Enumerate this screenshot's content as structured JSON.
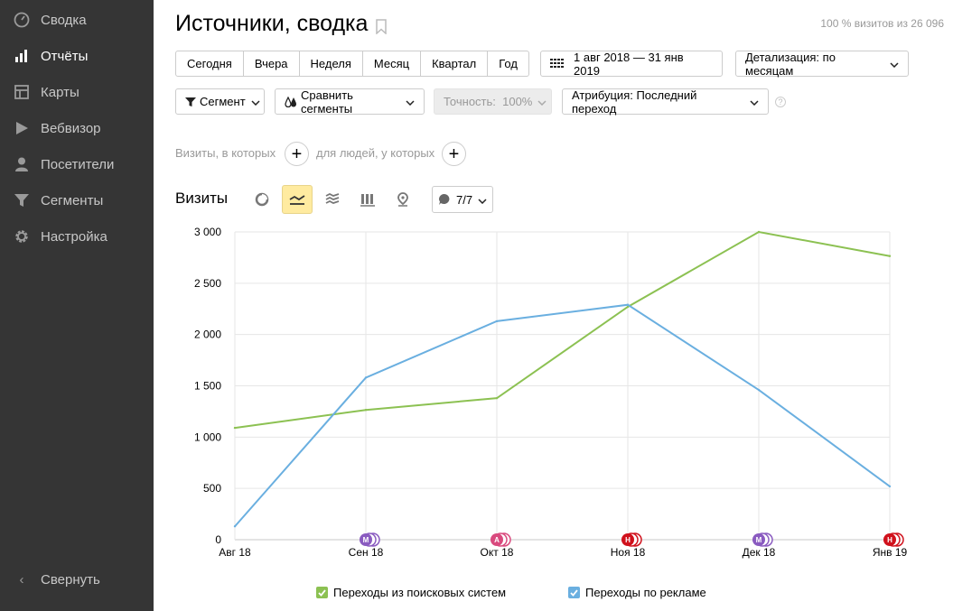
{
  "sidebar": {
    "items": [
      {
        "label": "Сводка",
        "icon": "gauge-icon",
        "active": false
      },
      {
        "label": "Отчёты",
        "icon": "bar-chart-icon",
        "active": true
      },
      {
        "label": "Карты",
        "icon": "map-icon",
        "active": false
      },
      {
        "label": "Вебвизор",
        "icon": "play-icon",
        "active": false
      },
      {
        "label": "Посетители",
        "icon": "user-icon",
        "active": false
      },
      {
        "label": "Сегменты",
        "icon": "funnel-icon",
        "active": false
      },
      {
        "label": "Настройка",
        "icon": "gear-icon",
        "active": false
      }
    ],
    "collapse_label": "Свернуть"
  },
  "header": {
    "title": "Источники, сводка",
    "coverage": "100 % визитов из 26 096"
  },
  "periods": [
    "Сегодня",
    "Вчера",
    "Неделя",
    "Месяц",
    "Квартал",
    "Год"
  ],
  "date_range": "1 авг 2018 — 31 янв 2019",
  "detail": "Детализация: по месяцам",
  "segment": "Сегмент",
  "compare": "Сравнить сегменты",
  "accuracy": "Точность:  100%",
  "attribution": "Атрибуция: Последний переход",
  "help": "?",
  "filters": {
    "visits_label": "Визиты, в которых",
    "people_label": "для людей, у которых"
  },
  "section_title": "Визиты",
  "notes_count": "7/7",
  "colors": {
    "sidebar": "#353535",
    "green": "#8cc152",
    "blue": "#6aafe0",
    "active_view": "#ffeba0"
  },
  "chart_data": {
    "type": "line",
    "categories": [
      "Авг 18",
      "Сен 18",
      "Окт 18",
      "Ноя 18",
      "Дек 18",
      "Янв 19"
    ],
    "ylim": [
      0,
      3000
    ],
    "yticks": [
      0,
      500,
      1000,
      1500,
      2000,
      2500,
      3000
    ],
    "ytick_labels": [
      "0",
      "500",
      "1 000",
      "1 500",
      "2 000",
      "2 500",
      "3 000"
    ],
    "grid": true,
    "legend_position": "bottom",
    "series": [
      {
        "name": "Переходы из поисковых систем",
        "color": "#8cc152",
        "values": [
          1090,
          1265,
          1380,
          2270,
          3000,
          2765
        ]
      },
      {
        "name": "Переходы по рекламе",
        "color": "#6aafe0",
        "values": [
          130,
          1580,
          2130,
          2290,
          1460,
          520
        ]
      }
    ],
    "annotations": [
      {
        "category": "Сен 18",
        "letters": [
          "М"
        ],
        "colors": [
          "#8a5bc0"
        ]
      },
      {
        "category": "Окт 18",
        "letters": [
          "А"
        ],
        "colors": [
          "#d94a7e"
        ]
      },
      {
        "category": "Ноя 18",
        "letters": [
          "Н"
        ],
        "colors": [
          "#d0111c"
        ]
      },
      {
        "category": "Дек 18",
        "letters": [
          "М"
        ],
        "colors": [
          "#8a5bc0"
        ]
      },
      {
        "category": "Янв 19",
        "letters": [
          "Н"
        ],
        "colors": [
          "#d0111c"
        ]
      }
    ]
  }
}
